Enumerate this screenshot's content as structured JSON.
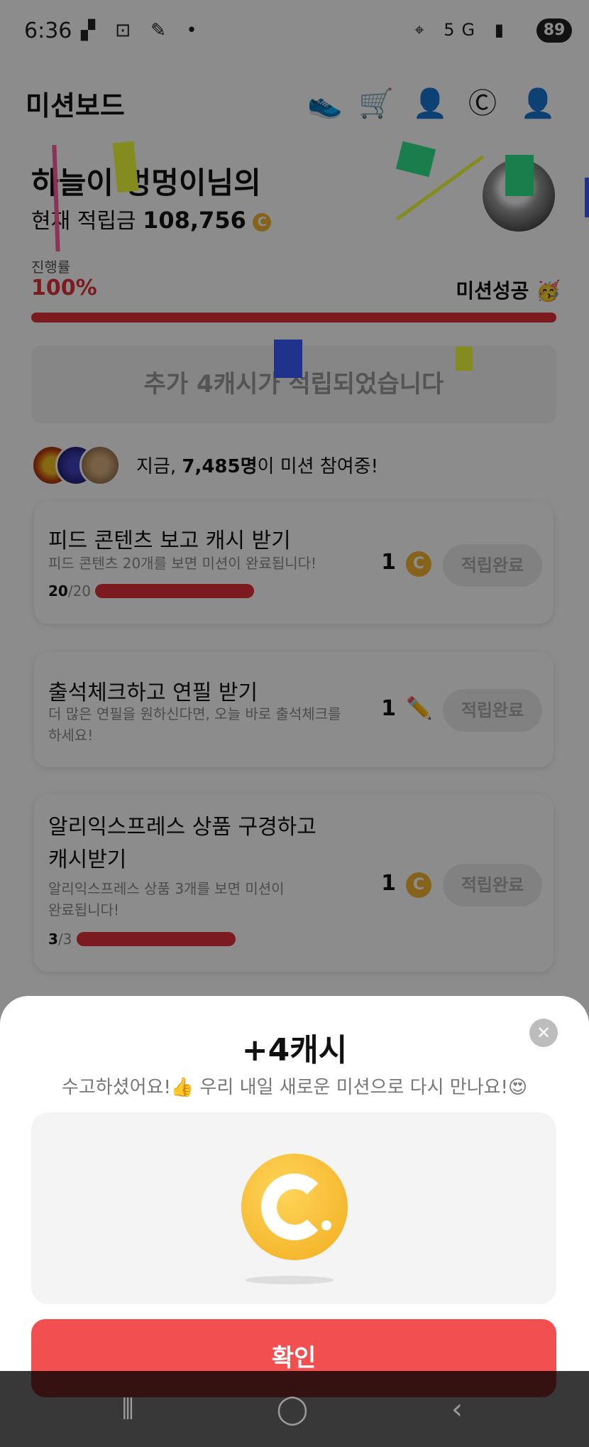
{
  "status_bar": {
    "time": "6:36",
    "network": "5G",
    "battery": "89"
  },
  "header": {
    "title": "미션보드",
    "icons": [
      "shoe-icon",
      "cart-icon",
      "add-friend-icon",
      "cash-coin-icon",
      "profile-icon"
    ]
  },
  "user": {
    "greeting": "하늘이 멍멍이님의",
    "savings_label": "현재 적립금",
    "savings_value": "108,756"
  },
  "progress": {
    "label": "진행률",
    "value": "100%",
    "fraction": 1.0,
    "success_text": "미션성공 🥳"
  },
  "notice": {
    "text": "추가 4캐시가 적립되었습니다"
  },
  "participants": {
    "prefix": "지금, ",
    "count": "7,485명",
    "suffix": "이 미션 참여중!"
  },
  "missions": [
    {
      "title": "피드 콘텐츠 보고 캐시 받기",
      "desc": "피드 콘텐츠 20개를 보면 미션이 완료됩니다!",
      "reward": "1",
      "reward_icon": "coin-icon",
      "button": "적립완료",
      "count_done": "20",
      "count_total": "/20",
      "progress": 1.0
    },
    {
      "title": "출석체크하고 연필 받기",
      "desc_line1": "더 많은 연필을 원하신다면, 오늘 바로 출석체크를",
      "desc_line2": "하세요!",
      "reward": "1",
      "reward_icon": "pencil-icon",
      "button": "적립완료"
    },
    {
      "title_line1": "알리익스프레스 상품 구경하고",
      "title_line2": "캐시받기",
      "desc_line1": "알리익스프레스 상품 3개를 보면 미션이",
      "desc_line2": "완료됩니다!",
      "reward": "1",
      "reward_icon": "coin-icon",
      "button": "적립완료",
      "count_done": "3",
      "count_total": "/3",
      "progress": 1.0
    }
  ],
  "sheet": {
    "amount": "+4캐시",
    "message": "수고하셨어요!👍 우리 내일 새로운 미션으로 다시 만나요!😍",
    "confirm": "확인",
    "close_glyph": "✕"
  },
  "colors": {
    "accent_red": "#e0323a",
    "button_red": "#f25050",
    "coin_gold": "#f3b530"
  }
}
